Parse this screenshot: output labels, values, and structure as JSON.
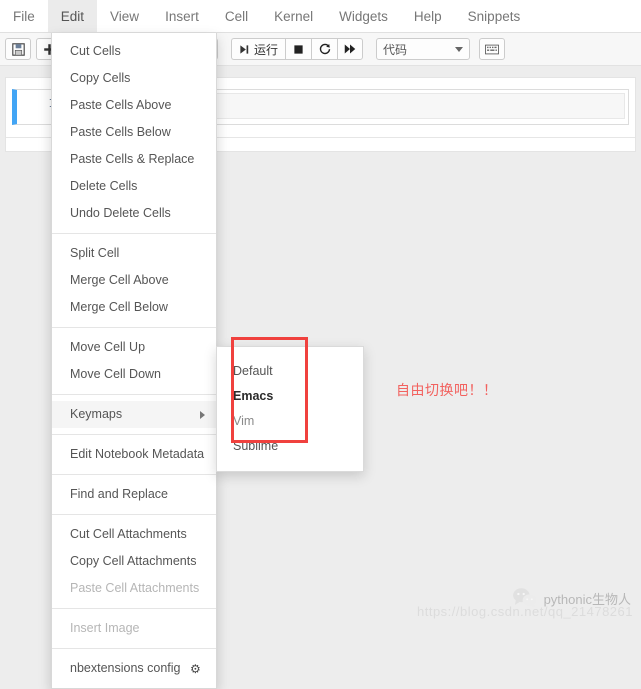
{
  "menubar": {
    "items": [
      {
        "label": "File",
        "active": false
      },
      {
        "label": "Edit",
        "active": true
      },
      {
        "label": "View",
        "active": false
      },
      {
        "label": "Insert",
        "active": false
      },
      {
        "label": "Cell",
        "active": false
      },
      {
        "label": "Kernel",
        "active": false
      },
      {
        "label": "Widgets",
        "active": false
      },
      {
        "label": "Help",
        "active": false
      },
      {
        "label": "Snippets",
        "active": false
      }
    ]
  },
  "toolbar": {
    "save_icon": "save-floppy-icon",
    "save_glyph": "ὋE",
    "add_label": "+",
    "cut_glyph": "✂",
    "copy_glyph": "⧉",
    "paste_glyph": "ὌB",
    "move_up_glyph": "↑",
    "move_down_glyph": "↓",
    "run_glyph": "▶|",
    "run_label": "运行",
    "stop_glyph": "■",
    "restart_glyph": "↻",
    "restart_run_all_glyph": "▶▶",
    "cell_type_value": "代码",
    "command_palette_glyph": "⌨"
  },
  "notebook": {
    "cell_prompt": "In",
    "cell_value": ""
  },
  "edit_menu": {
    "groups": [
      {
        "items": [
          {
            "label": "Cut Cells",
            "disabled": false,
            "highlight": false
          },
          {
            "label": "Copy Cells",
            "disabled": false,
            "highlight": false
          },
          {
            "label": "Paste Cells Above",
            "disabled": false,
            "highlight": false
          },
          {
            "label": "Paste Cells Below",
            "disabled": false,
            "highlight": false
          },
          {
            "label": "Paste Cells & Replace",
            "disabled": false,
            "highlight": false
          },
          {
            "label": "Delete Cells",
            "disabled": false,
            "highlight": false
          },
          {
            "label": "Undo Delete Cells",
            "disabled": false,
            "highlight": false
          }
        ]
      },
      {
        "items": [
          {
            "label": "Split Cell",
            "disabled": false,
            "highlight": false
          },
          {
            "label": "Merge Cell Above",
            "disabled": false,
            "highlight": false
          },
          {
            "label": "Merge Cell Below",
            "disabled": false,
            "highlight": false
          }
        ]
      },
      {
        "items": [
          {
            "label": "Move Cell Up",
            "disabled": false,
            "highlight": false
          },
          {
            "label": "Move Cell Down",
            "disabled": false,
            "highlight": false
          }
        ]
      },
      {
        "items": [
          {
            "label": "Keymaps",
            "disabled": false,
            "highlight": true,
            "submenu": true
          }
        ]
      },
      {
        "items": [
          {
            "label": "Edit Notebook Metadata",
            "disabled": false,
            "highlight": false
          }
        ]
      },
      {
        "items": [
          {
            "label": "Find and Replace",
            "disabled": false,
            "highlight": false
          }
        ]
      },
      {
        "items": [
          {
            "label": "Cut Cell Attachments",
            "disabled": false,
            "highlight": false
          },
          {
            "label": "Copy Cell Attachments",
            "disabled": false,
            "highlight": false
          },
          {
            "label": "Paste Cell Attachments",
            "disabled": true,
            "highlight": false
          }
        ]
      },
      {
        "items": [
          {
            "label": "Insert Image",
            "disabled": true,
            "highlight": false
          }
        ]
      },
      {
        "items": [
          {
            "label": "nbextensions config",
            "disabled": false,
            "highlight": false,
            "gear": true
          }
        ]
      }
    ],
    "gear_glyph": "⚙"
  },
  "keymaps_submenu": {
    "items": [
      {
        "label": "Default",
        "state": "normal"
      },
      {
        "label": "Emacs",
        "state": "bold"
      },
      {
        "label": "Vim",
        "state": "muted"
      },
      {
        "label": "Sublime",
        "state": "normal"
      }
    ]
  },
  "annotation": {
    "text": "自由切换吧！！",
    "color": "#f2625f"
  },
  "watermarks": {
    "wechat_account": "pythonic生物人",
    "blog_url": "https://blog.csdn.net/qq_21478261"
  },
  "colors": {
    "accent_red": "#f0413e",
    "selected_cell_blue": "#42a5f5",
    "menu_active_bg": "#ebebeb"
  }
}
